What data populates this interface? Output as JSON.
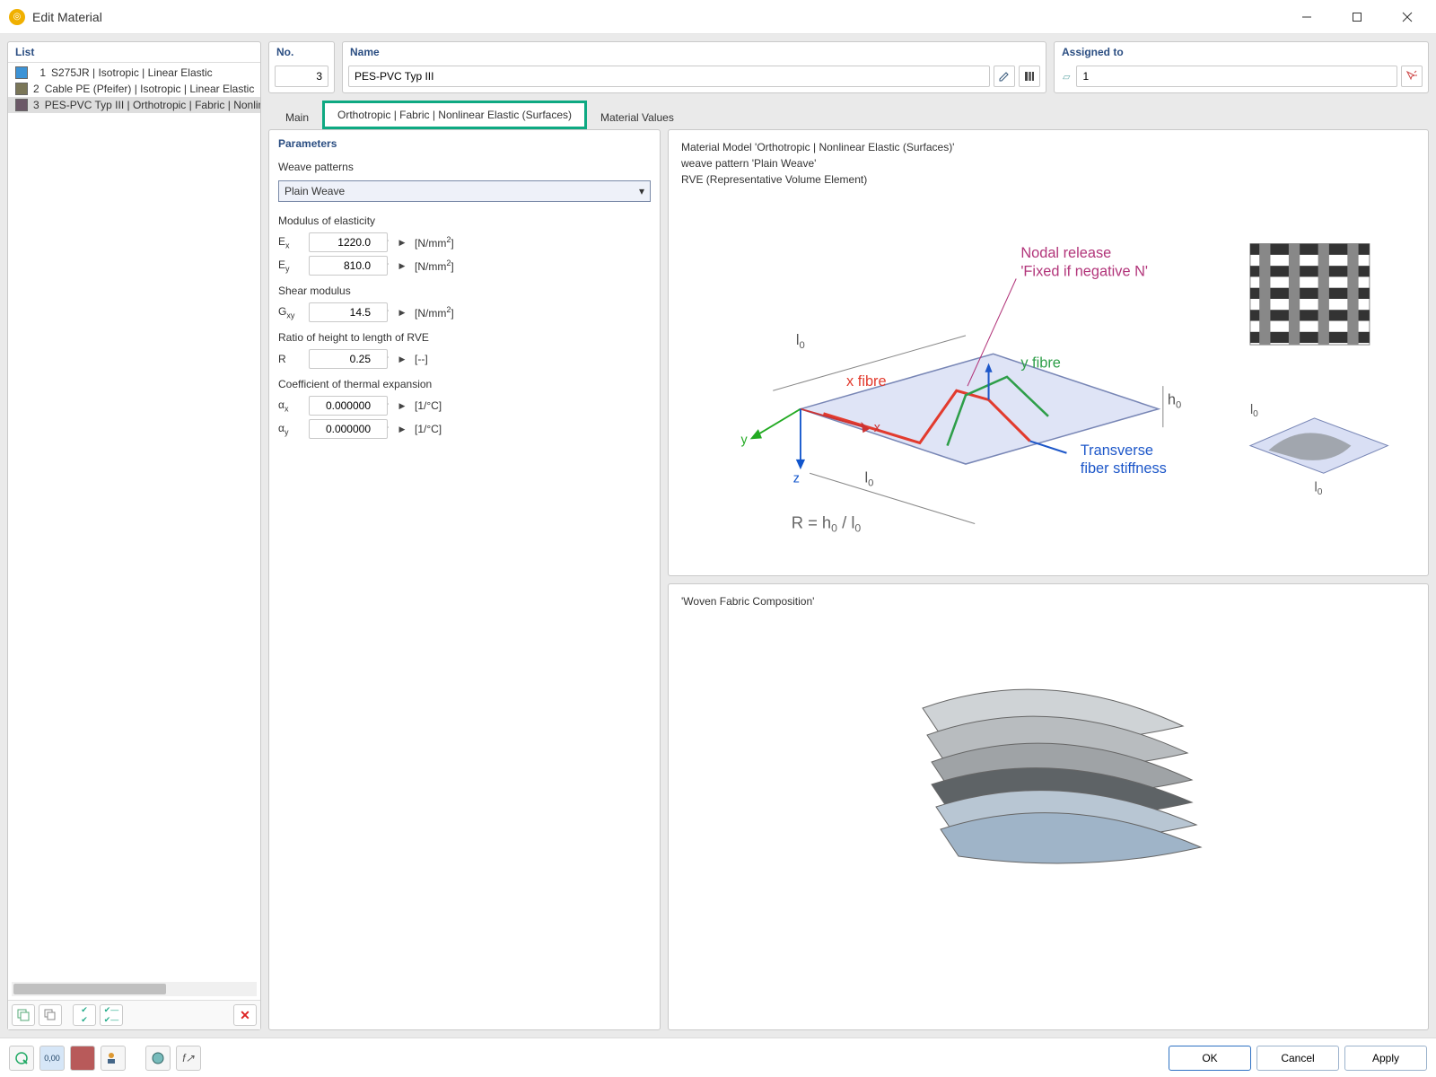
{
  "window": {
    "title": "Edit Material"
  },
  "left": {
    "header": "List",
    "items": [
      {
        "num": "1",
        "label": "S275JR | Isotropic | Linear Elastic",
        "color": "#3c93d6",
        "selected": false
      },
      {
        "num": "2",
        "label": "Cable PE (Pfeifer) | Isotropic | Linear Elastic",
        "color": "#7a7658",
        "selected": false
      },
      {
        "num": "3",
        "label": "PES-PVC Typ III | Orthotropic | Fabric | Nonlinear Elastic (Surfaces)",
        "color": "#6b5867",
        "selected": true
      }
    ]
  },
  "topfields": {
    "no_label": "No.",
    "no_value": "3",
    "name_label": "Name",
    "name_value": "PES-PVC Typ III",
    "assigned_label": "Assigned to",
    "assigned_value": "1"
  },
  "tabs": {
    "main": "Main",
    "ortho": "Orthotropic | Fabric | Nonlinear Elastic (Surfaces)",
    "matvals": "Material Values"
  },
  "params": {
    "section_title": "Parameters",
    "weave_label": "Weave patterns",
    "weave_value": "Plain Weave",
    "modulus_label": "Modulus of elasticity",
    "ex_sym": "E",
    "ex_sub": "x",
    "ex_val": "1220.0",
    "ex_unit": "[N/mm",
    "sq": "2",
    "ex_unit_end": "]",
    "ey_sym": "E",
    "ey_sub": "y",
    "ey_val": "810.0",
    "shear_label": "Shear modulus",
    "gxy_sym": "G",
    "gxy_sub": "xy",
    "gxy_val": "14.5",
    "ratio_label": "Ratio of height to length of RVE",
    "r_sym": "R",
    "r_val": "0.25",
    "r_unit": "[--]",
    "cte_label": "Coefficient of thermal expansion",
    "ax_sym": "α",
    "ax_sub": "x",
    "ax_val": "0.000000",
    "cte_unit": "[1/°C]",
    "ay_sym": "α",
    "ay_sub": "y",
    "ay_val": "0.000000"
  },
  "preview1": {
    "line1": "Material Model 'Orthotropic | Nonlinear Elastic (Surfaces)'",
    "line2": "weave pattern 'Plain Weave'",
    "line3": "RVE (Representative Volume Element)",
    "xfibre": "x fibre",
    "yfibre": "y fibre",
    "nodal1": "Nodal release",
    "nodal2": "'Fixed if negative N'",
    "trans1": "Transverse",
    "trans2": "fiber stiffness",
    "l0": "l",
    "l0sub": "0",
    "h0": "h",
    "h0sub": "0",
    "x": "x",
    "y": "y",
    "z": "z",
    "req": "R = h",
    "req2": " / l"
  },
  "preview2": {
    "title": "'Woven Fabric Composition'"
  },
  "buttons": {
    "ok": "OK",
    "cancel": "Cancel",
    "apply": "Apply"
  }
}
